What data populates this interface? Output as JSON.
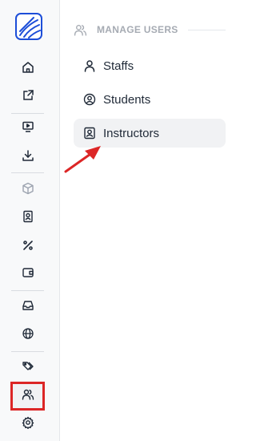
{
  "app": {
    "logo_icon": "app-logo-icon"
  },
  "rail": {
    "items": [
      {
        "name": "home-icon"
      },
      {
        "name": "external-link-icon"
      },
      {
        "name": "monitor-play-icon"
      },
      {
        "name": "download-icon"
      },
      {
        "name": "box-icon"
      },
      {
        "name": "contact-card-icon"
      },
      {
        "name": "percent-icon"
      },
      {
        "name": "wallet-icon"
      },
      {
        "name": "inbox-icon"
      },
      {
        "name": "globe-icon"
      },
      {
        "name": "tags-icon"
      },
      {
        "name": "users-icon",
        "active": true
      },
      {
        "name": "settings-gear-icon"
      }
    ],
    "active_border_color": "#dc2626"
  },
  "panel": {
    "section_title": "MANAGE USERS",
    "section_icon": "users-icon",
    "items": [
      {
        "label": "Staffs",
        "icon": "user-icon",
        "selected": false
      },
      {
        "label": "Students",
        "icon": "user-circle-icon",
        "selected": false
      },
      {
        "label": "Instructors",
        "icon": "user-square-icon",
        "selected": true
      }
    ]
  },
  "annotation": {
    "arrow_color": "#dc2626",
    "points_to": "Instructors"
  }
}
